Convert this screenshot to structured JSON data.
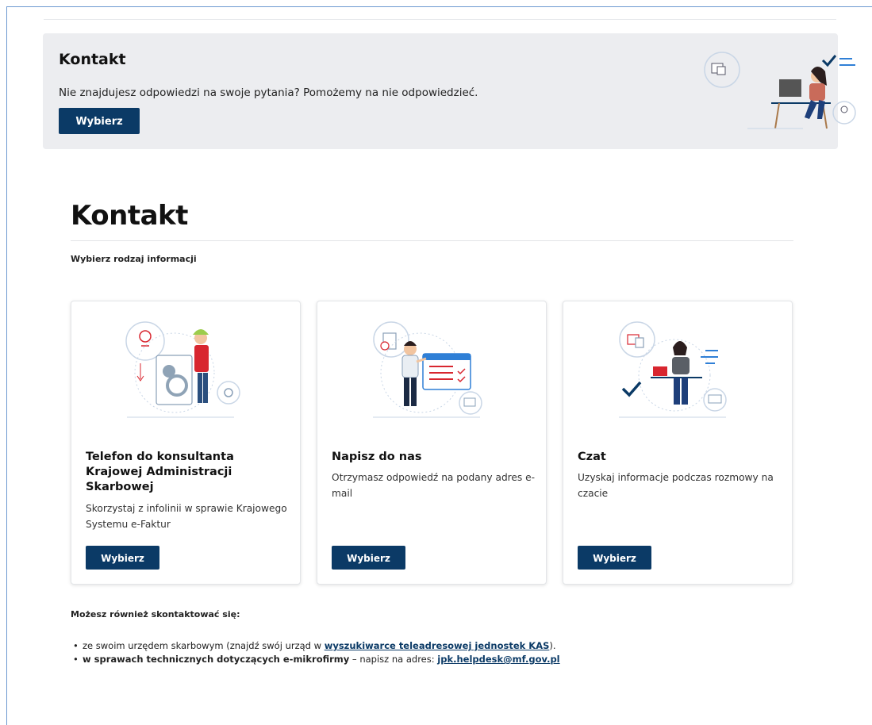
{
  "banner": {
    "title": "Kontakt",
    "text": "Nie znajdujesz odpowiedzi na swoje pytania? Pomożemy na nie odpowiedzieć.",
    "button": "Wybierz"
  },
  "main": {
    "title": "Kontakt",
    "subtitle": "Wybierz rodzaj informacji"
  },
  "cards": [
    {
      "title": "Telefon do konsultanta Krajowej Administracji Skarbowej",
      "description": "Skorzystaj z infolinii w sprawie Krajowego Systemu e-Faktur",
      "button": "Wybierz"
    },
    {
      "title": "Napisz do nas",
      "description": "Otrzymasz odpowiedź na podany adres e-mail",
      "button": "Wybierz"
    },
    {
      "title": "Czat",
      "description": "Uzyskaj informacje podczas rozmowy na czacie",
      "button": "Wybierz"
    }
  ],
  "also": {
    "title": "Możesz również skontaktować się:",
    "item1_prefix": "ze swoim urzędem skarbowym (znajdź swój urząd w ",
    "item1_link": "wyszukiwarce teleadresowej jednostek KAS",
    "item1_suffix": ").",
    "item2_bold": "w sprawach technicznych dotyczących e-mikrofirmy",
    "item2_text": " – napisz na adres: ",
    "item2_link": "jpk.helpdesk@mf.gov.pl"
  },
  "colors": {
    "primary": "#0b3a66",
    "banner_bg": "#ecedf0",
    "accent_red": "#d8262f",
    "accent_blue": "#2f7fd6"
  }
}
